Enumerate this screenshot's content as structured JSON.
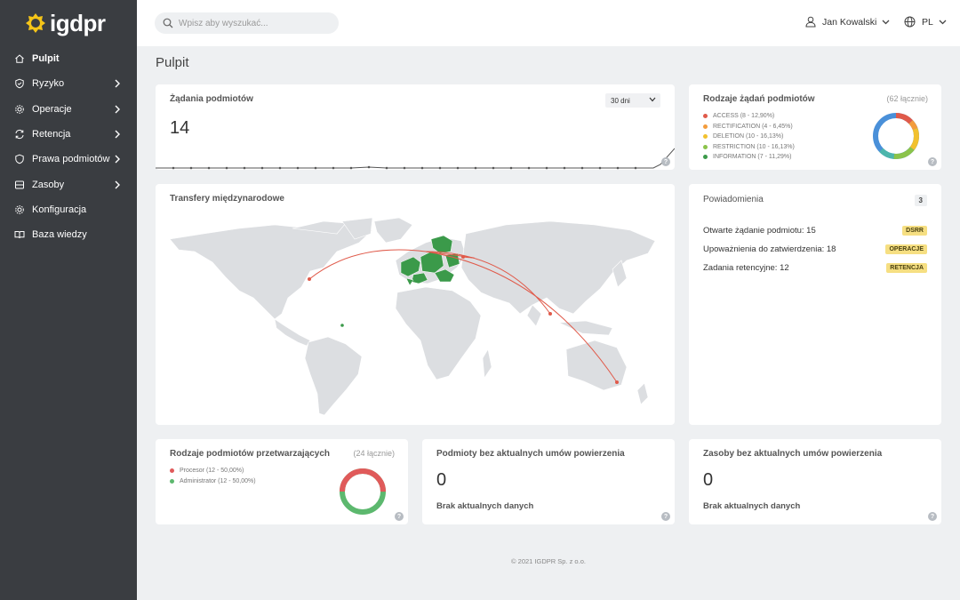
{
  "app": {
    "name": "igdpr",
    "brand_color": "#f5c518"
  },
  "sidebar": {
    "items": [
      {
        "label": "Pulpit",
        "icon": "home-icon",
        "active": true
      },
      {
        "label": "Ryzyko",
        "icon": "shield-icon",
        "has_children": true
      },
      {
        "label": "Operacje",
        "icon": "gear-icon",
        "has_children": true
      },
      {
        "label": "Retencja",
        "icon": "sync-icon",
        "has_children": true
      },
      {
        "label": "Prawa podmiotów",
        "icon": "shield-icon",
        "has_children": true
      },
      {
        "label": "Zasoby",
        "icon": "storage-icon",
        "has_children": true
      },
      {
        "label": "Konfiguracja",
        "icon": "gear-icon"
      },
      {
        "label": "Baza wiedzy",
        "icon": "book-icon"
      }
    ]
  },
  "header": {
    "search_placeholder": "Wpisz aby wyszukać...",
    "user_name": "Jan Kowalski",
    "language": "PL"
  },
  "page": {
    "title": "Pulpit"
  },
  "requests_card": {
    "title": "Żądania podmiotów",
    "period": "30 dni",
    "value": "14",
    "help": "?"
  },
  "request_types_card": {
    "title": "Rodzaje żądań podmiotów",
    "total": "(62 łącznie)",
    "help": "?",
    "legend": [
      {
        "label": "ACCESS (8 - 12,90%)",
        "color": "#e05a4a"
      },
      {
        "label": "RECTIFICATION (4 - 6,45%)",
        "color": "#f39c3c"
      },
      {
        "label": "DELETION (10 - 16,13%)",
        "color": "#f2c12e"
      },
      {
        "label": "RESTRICTION (10 - 16,13%)",
        "color": "#8bc34a"
      },
      {
        "label": "INFORMATION (7 - 11,29%)",
        "color": "#3b9a4a"
      }
    ]
  },
  "transfers_card": {
    "title": "Transfery międzynarodowe"
  },
  "notifications_card": {
    "title": "Powiadomienia",
    "count": "3",
    "rows": [
      {
        "text": "Otwarte żądanie podmiotu: 15",
        "badge": "DSRR"
      },
      {
        "text": "Upoważnienia do zatwierdzenia: 18",
        "badge": "OPERACJE"
      },
      {
        "text": "Zadania retencyjne: 12",
        "badge": "RETENCJA"
      }
    ]
  },
  "processors_card": {
    "title": "Rodzaje podmiotów przetwarzających",
    "total": "(24 łącznie)",
    "help": "?",
    "legend": [
      {
        "label": "Procesor (12 - 50,00%)",
        "color": "#e05a5a"
      },
      {
        "label": "Administrator (12 - 50,00%)",
        "color": "#5cb86e"
      }
    ]
  },
  "entities_card": {
    "title": "Podmioty bez aktualnych umów powierzenia",
    "value": "0",
    "empty": "Brak aktualnych danych",
    "help": "?"
  },
  "assets_card": {
    "title": "Zasoby bez aktualnych umów powierzenia",
    "value": "0",
    "empty": "Brak aktualnych danych",
    "help": "?"
  },
  "footer": {
    "text": "© 2021 IGDPR Sp. z o.o."
  }
}
